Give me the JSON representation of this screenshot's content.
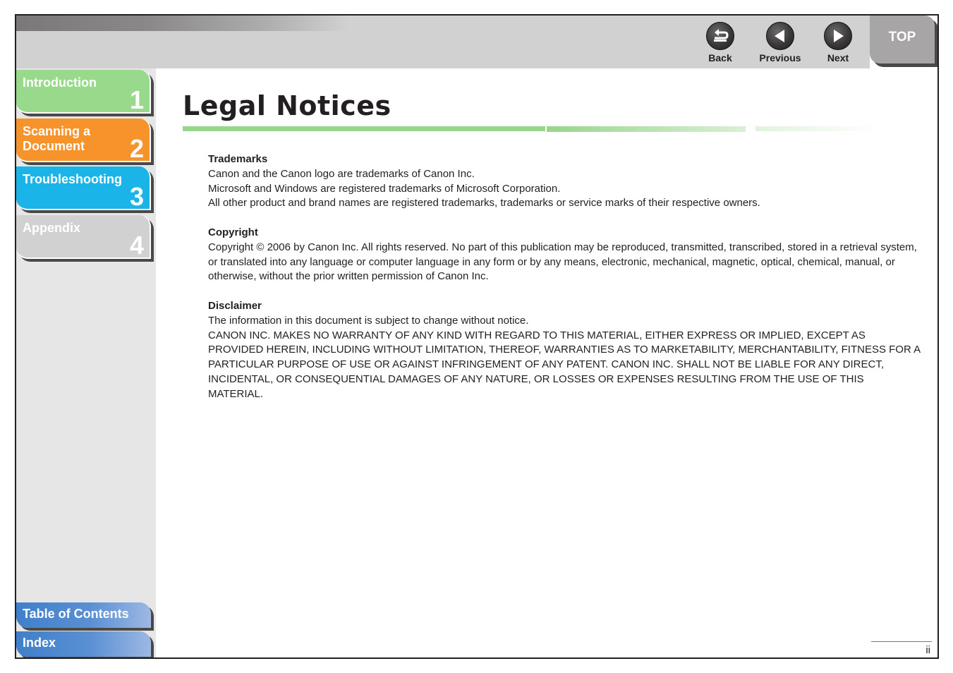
{
  "nav": {
    "back_label": "Back",
    "previous_label": "Previous",
    "next_label": "Next",
    "top_label": "TOP"
  },
  "sidebar": {
    "chapters": [
      {
        "label": "Introduction",
        "number": "1",
        "color": "#99d98b"
      },
      {
        "label": "Scanning a Document",
        "number": "2",
        "color": "#f6932a"
      },
      {
        "label": "Troubleshooting",
        "number": "3",
        "color": "#1ab4e8"
      },
      {
        "label": "Appendix",
        "number": "4",
        "color": "#d1d1d1"
      }
    ],
    "table_of_contents": "Table of Contents",
    "index": "Index"
  },
  "page": {
    "title": "Legal Notices",
    "sections": [
      {
        "heading": "Trademarks",
        "lines": [
          "Canon and the Canon logo are trademarks of Canon Inc.",
          "Microsoft and Windows are registered trademarks of Microsoft Corporation.",
          "All other product and brand names are registered trademarks, trademarks or service marks of their respective owners."
        ]
      },
      {
        "heading": "Copyright",
        "lines": [
          "Copyright © 2006 by Canon Inc. All rights reserved. No part of this publication may be reproduced, transmitted, transcribed, stored in a retrieval system, or translated into any language or computer language in any form or by any means, electronic, mechanical, magnetic, optical, chemical, manual, or otherwise, without the prior written permission of Canon Inc."
        ]
      },
      {
        "heading": "Disclaimer",
        "lines": [
          "The information in this document is subject to change without notice.",
          "CANON INC. MAKES NO WARRANTY OF ANY KIND WITH REGARD TO THIS MATERIAL, EITHER EXPRESS OR IMPLIED, EXCEPT AS PROVIDED HEREIN, INCLUDING WITHOUT LIMITATION, THEREOF, WARRANTIES AS TO MARKETABILITY, MERCHANTABILITY, FITNESS FOR A PARTICULAR PURPOSE OF USE OR AGAINST INFRINGEMENT OF ANY PATENT. CANON INC. SHALL NOT BE LIABLE FOR ANY DIRECT, INCIDENTAL, OR CONSEQUENTIAL DAMAGES OF ANY NATURE, OR LOSSES OR EXPENSES RESULTING FROM THE USE OF THIS MATERIAL."
        ]
      }
    ],
    "page_number": "ii"
  }
}
